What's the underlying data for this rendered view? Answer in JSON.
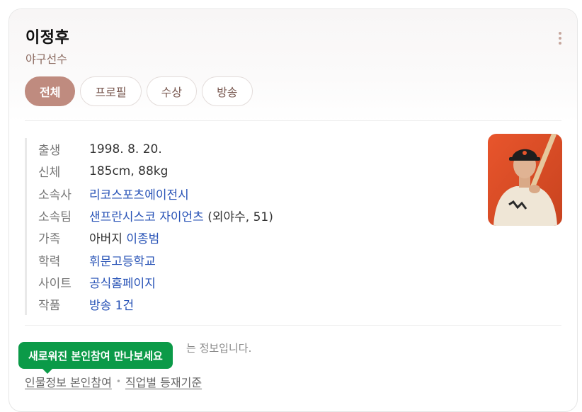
{
  "profile": {
    "name": "이정후",
    "occupation": "야구선수",
    "more_icon": "more-vertical-icon"
  },
  "tabs": [
    {
      "label": "전체",
      "active": true
    },
    {
      "label": "프로필",
      "active": false
    },
    {
      "label": "수상",
      "active": false
    },
    {
      "label": "방송",
      "active": false
    }
  ],
  "info": {
    "birth": {
      "label": "출생",
      "value": "1998. 8. 20."
    },
    "body": {
      "label": "신체",
      "value": "185cm, 88kg"
    },
    "agency": {
      "label": "소속사",
      "value": "리코스포츠에이전시"
    },
    "team": {
      "label": "소속팀",
      "value": "샌프란시스코 자이언츠",
      "extra": " (외야수, 51)"
    },
    "family": {
      "label": "가족",
      "prefix": "아버지 ",
      "value": "이종범"
    },
    "education": {
      "label": "학력",
      "value": "휘문고등학교"
    },
    "site": {
      "label": "사이트",
      "value": "공식홈페이지"
    },
    "works": {
      "label": "작품",
      "value": "방송 1건"
    }
  },
  "notice": "는 정보입니다.",
  "tooltip": "새로워진 본인참여 만나보세요",
  "footer": {
    "link1": "인물정보 본인참여",
    "link2": "직업별 등재기준"
  },
  "colors": {
    "accent": "#bf8b7f",
    "link": "#2752b6",
    "tooltip": "#0b9a48"
  }
}
